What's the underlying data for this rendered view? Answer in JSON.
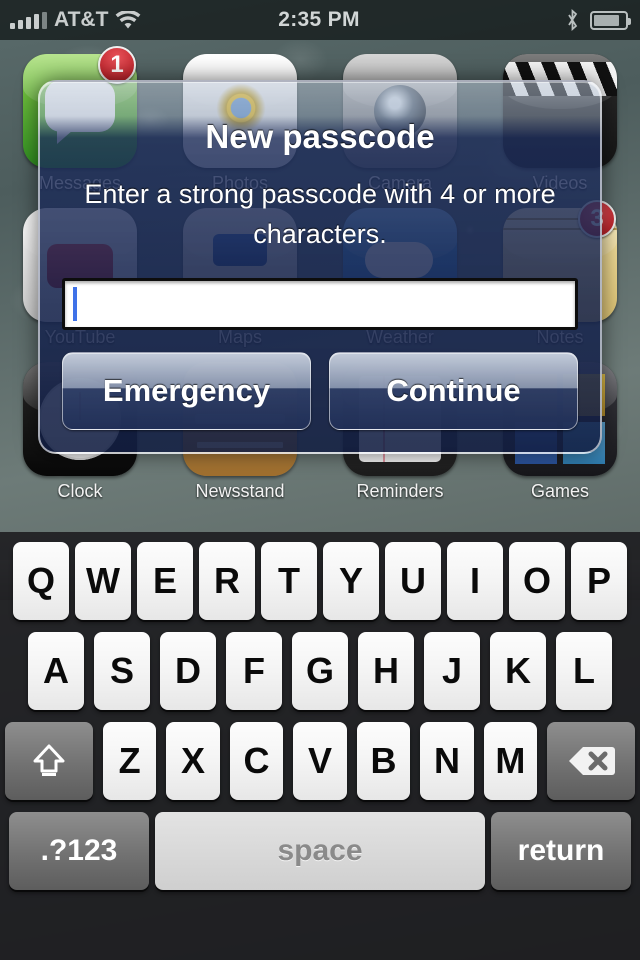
{
  "status_bar": {
    "carrier": "AT&T",
    "time": "2:35 PM",
    "signal_icon": "signal-bars-icon",
    "wifi_icon": "wifi-icon",
    "bluetooth_icon": "bluetooth-icon",
    "battery_icon": "battery-icon"
  },
  "springboard": {
    "apps": [
      {
        "label": "Messages",
        "icon": "messages-icon",
        "badge": "1"
      },
      {
        "label": "Photos",
        "icon": "photos-icon",
        "badge": ""
      },
      {
        "label": "Camera",
        "icon": "camera-icon",
        "badge": ""
      },
      {
        "label": "Videos",
        "icon": "videos-icon",
        "badge": ""
      },
      {
        "label": "YouTube",
        "icon": "youtube-icon",
        "badge": ""
      },
      {
        "label": "Maps",
        "icon": "maps-icon",
        "badge": ""
      },
      {
        "label": "Weather",
        "icon": "weather-icon",
        "badge": ""
      },
      {
        "label": "Notes",
        "icon": "notes-icon",
        "badge": "3"
      },
      {
        "label": "Clock",
        "icon": "clock-icon",
        "badge": ""
      },
      {
        "label": "Newsstand",
        "icon": "newsstand-icon",
        "badge": ""
      },
      {
        "label": "Reminders",
        "icon": "reminders-icon",
        "badge": ""
      },
      {
        "label": "Games",
        "icon": "games-folder-icon",
        "badge": ""
      }
    ]
  },
  "alert": {
    "title": "New passcode",
    "message": "Enter a strong passcode with 4 or more characters.",
    "field": {
      "value": "",
      "placeholder": ""
    },
    "buttons": [
      {
        "label": "Emergency",
        "name": "emergency-button"
      },
      {
        "label": "Continue",
        "name": "continue-button"
      }
    ]
  },
  "keyboard": {
    "row1": [
      "Q",
      "W",
      "E",
      "R",
      "T",
      "Y",
      "U",
      "I",
      "O",
      "P"
    ],
    "row2": [
      "A",
      "S",
      "D",
      "F",
      "G",
      "H",
      "J",
      "K",
      "L"
    ],
    "row3": [
      "Z",
      "X",
      "C",
      "V",
      "B",
      "N",
      "M"
    ],
    "shift_label": "",
    "delete_label": "",
    "numbers_label": ".?123",
    "space_label": "space",
    "return_label": "return",
    "shift_icon": "shift-icon",
    "delete_icon": "delete-icon"
  },
  "colors": {
    "caret": "#3f72e8",
    "badge": "#b0141c",
    "alert_tint": "#1e2e5c"
  }
}
